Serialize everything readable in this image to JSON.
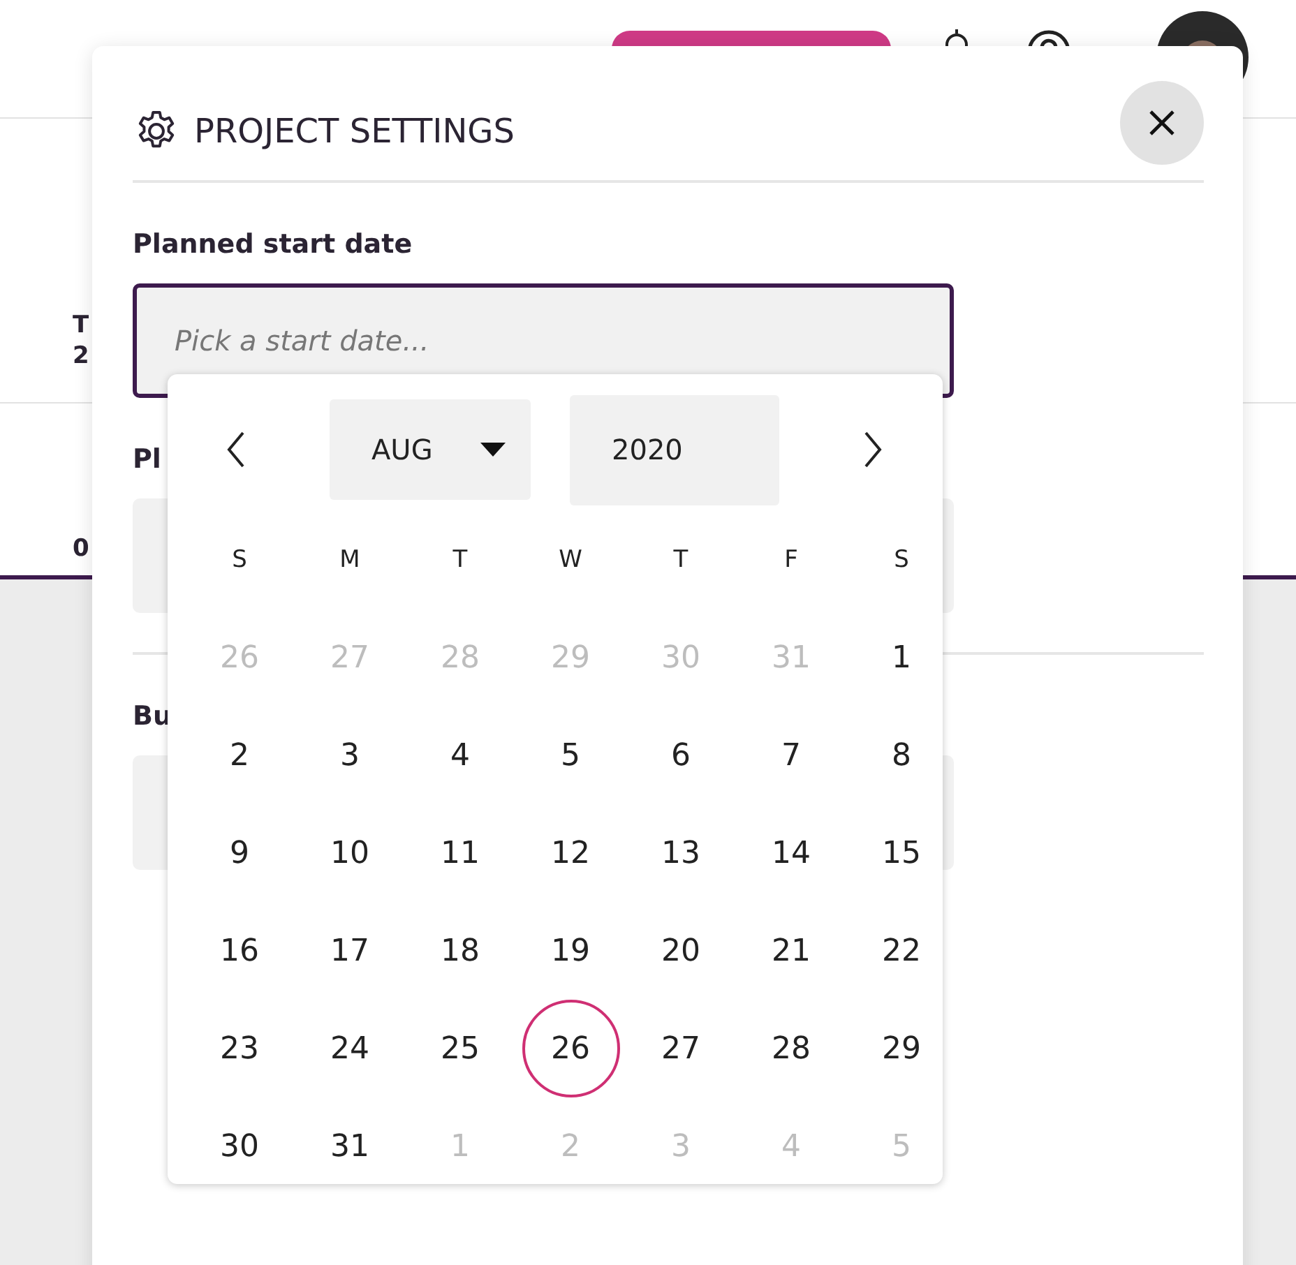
{
  "background_page": {
    "day_label": "T",
    "day_number": "2",
    "cell_value": "0"
  },
  "modal": {
    "title": "PROJECT SETTINGS",
    "fields": [
      {
        "label": "Planned start date",
        "placeholder": "Pick a start date...",
        "focused": true
      },
      {
        "label": "Pl",
        "focused": false
      },
      {
        "label": "Bu",
        "focused": false
      }
    ]
  },
  "date_picker": {
    "month": "AUG",
    "year": "2020",
    "weekdays": [
      "S",
      "M",
      "T",
      "W",
      "T",
      "F",
      "S"
    ],
    "weeks": [
      [
        {
          "day": "26",
          "outside": true,
          "today": false
        },
        {
          "day": "27",
          "outside": true,
          "today": false
        },
        {
          "day": "28",
          "outside": true,
          "today": false
        },
        {
          "day": "29",
          "outside": true,
          "today": false
        },
        {
          "day": "30",
          "outside": true,
          "today": false
        },
        {
          "day": "31",
          "outside": true,
          "today": false
        },
        {
          "day": "1",
          "outside": false,
          "today": false
        }
      ],
      [
        {
          "day": "2",
          "outside": false,
          "today": false
        },
        {
          "day": "3",
          "outside": false,
          "today": false
        },
        {
          "day": "4",
          "outside": false,
          "today": false
        },
        {
          "day": "5",
          "outside": false,
          "today": false
        },
        {
          "day": "6",
          "outside": false,
          "today": false
        },
        {
          "day": "7",
          "outside": false,
          "today": false
        },
        {
          "day": "8",
          "outside": false,
          "today": false
        }
      ],
      [
        {
          "day": "9",
          "outside": false,
          "today": false
        },
        {
          "day": "10",
          "outside": false,
          "today": false
        },
        {
          "day": "11",
          "outside": false,
          "today": false
        },
        {
          "day": "12",
          "outside": false,
          "today": false
        },
        {
          "day": "13",
          "outside": false,
          "today": false
        },
        {
          "day": "14",
          "outside": false,
          "today": false
        },
        {
          "day": "15",
          "outside": false,
          "today": false
        }
      ],
      [
        {
          "day": "16",
          "outside": false,
          "today": false
        },
        {
          "day": "17",
          "outside": false,
          "today": false
        },
        {
          "day": "18",
          "outside": false,
          "today": false
        },
        {
          "day": "19",
          "outside": false,
          "today": false
        },
        {
          "day": "20",
          "outside": false,
          "today": false
        },
        {
          "day": "21",
          "outside": false,
          "today": false
        },
        {
          "day": "22",
          "outside": false,
          "today": false
        }
      ],
      [
        {
          "day": "23",
          "outside": false,
          "today": false
        },
        {
          "day": "24",
          "outside": false,
          "today": false
        },
        {
          "day": "25",
          "outside": false,
          "today": false
        },
        {
          "day": "26",
          "outside": false,
          "today": true
        },
        {
          "day": "27",
          "outside": false,
          "today": false
        },
        {
          "day": "28",
          "outside": false,
          "today": false
        },
        {
          "day": "29",
          "outside": false,
          "today": false
        }
      ],
      [
        {
          "day": "30",
          "outside": false,
          "today": false
        },
        {
          "day": "31",
          "outside": false,
          "today": false
        },
        {
          "day": "1",
          "outside": true,
          "today": false
        },
        {
          "day": "2",
          "outside": true,
          "today": false
        },
        {
          "day": "3",
          "outside": true,
          "today": false
        },
        {
          "day": "4",
          "outside": true,
          "today": false
        },
        {
          "day": "5",
          "outside": true,
          "today": false
        }
      ]
    ]
  }
}
